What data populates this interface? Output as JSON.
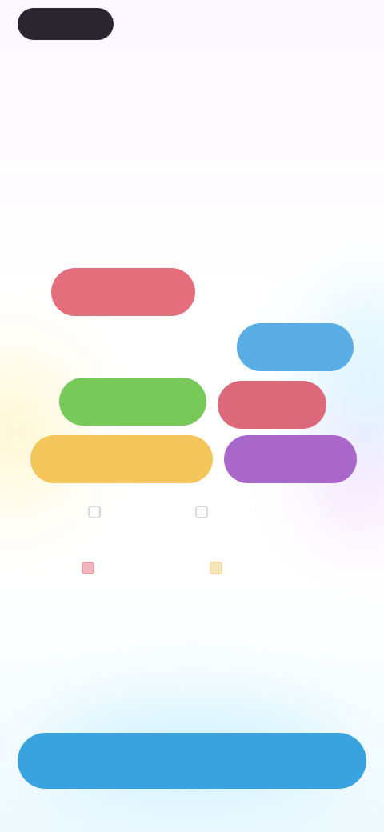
{
  "header": {
    "logo_label": "",
    "top_right_label": "",
    "skip_label": ""
  },
  "title": {
    "text": "",
    "subtitle": ""
  },
  "chips": [
    {
      "label": "",
      "color": "#e56e7d"
    },
    {
      "label": "",
      "color": "#5aaee5"
    },
    {
      "label": "",
      "color": "#77c95a"
    },
    {
      "label": "",
      "color": "#dc6a7a"
    },
    {
      "label": "",
      "color": "#f2c65a"
    },
    {
      "label": "",
      "color": "#a867c9"
    }
  ],
  "faint_labels": [
    "",
    ""
  ],
  "options": [
    {
      "label": "",
      "icon": "checkbox-icon"
    },
    {
      "label": "",
      "icon": "checkbox-icon"
    },
    {
      "label": "",
      "icon": "checkbox-icon",
      "color": "#f0b6be"
    },
    {
      "label": "",
      "icon": "checkbox-icon",
      "color": "#f8e6bb"
    }
  ],
  "link_label": "",
  "continue_label": ""
}
